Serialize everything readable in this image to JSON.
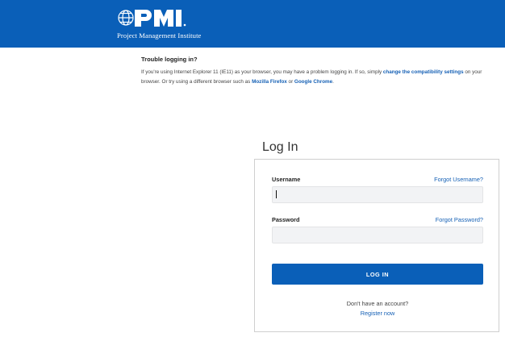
{
  "header": {
    "logo_text": "PMI",
    "logo_subtitle": "Project Management Institute",
    "brand_color": "#0a5fb8"
  },
  "notice": {
    "title": "Trouble logging in?",
    "text_1": "If you're using Internet Explorer 11 (IE11) as your browser, you may have a problem logging in. If so, simply ",
    "link_compat": "change the compatibility settings",
    "text_2": " on your browser. Or try using a different browser such as ",
    "link_firefox": "Mozilla Firefox",
    "text_3": " or ",
    "link_chrome": "Google Chrome",
    "text_4": "."
  },
  "login": {
    "title": "Log In",
    "username_label": "Username",
    "forgot_username": "Forgot Username?",
    "username_value": "",
    "password_label": "Password",
    "forgot_password": "Forgot Password?",
    "password_value": "",
    "submit_label": "LOG IN",
    "no_account_text": "Don't have an account?",
    "register_label": "Register now"
  },
  "colors": {
    "link": "#1560b5",
    "input_bg": "#f2f3f5"
  }
}
